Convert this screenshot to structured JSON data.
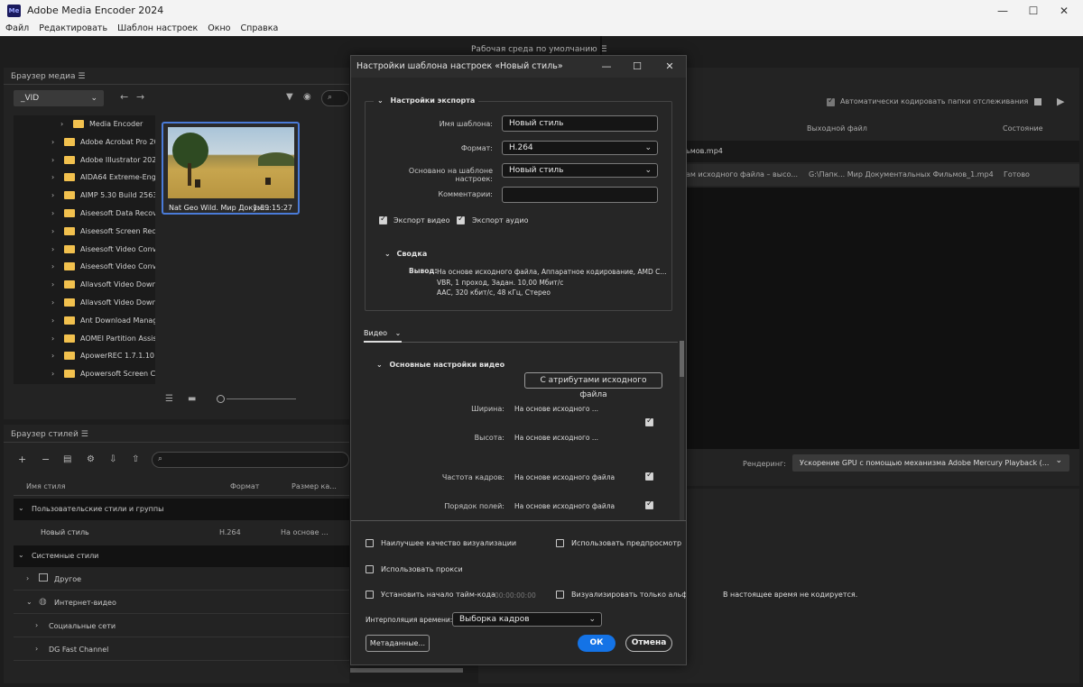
{
  "window": {
    "app_icon": "Me",
    "title": "Adobe Media Encoder 2024",
    "minimize": "—",
    "maximize": "☐",
    "close": "✕"
  },
  "menu": [
    "Файл",
    "Редактировать",
    "Шаблон настроек",
    "Окно",
    "Справка"
  ],
  "workspace": {
    "label": "Рабочая среда по умолчанию",
    "menu_icon": "☰"
  },
  "media_browser": {
    "title": "Браузер медиа",
    "menu_icon": "☰",
    "location": "_VID",
    "search_placeholder": "",
    "tree": [
      "Media Encoder",
      "Adobe Acrobat Pro 20",
      "Adobe Illustrator 2024",
      "AIDA64 Extreme-Engi",
      "AIMP 5.30 Build 2563",
      "Aiseesoft Data Recove",
      "Aiseesoft Screen Reco",
      "Aiseesoft Video Conv",
      "Aiseesoft Video Conv",
      "Allavsoft Video Down",
      "Allavsoft Video Down",
      "Ant Download Manag",
      "AOMEI Partition Assis",
      "ApowerREC 1.7.1.10 Re",
      "Apowersoft Screen Ca"
    ],
    "thumbnail": {
      "name": "Nat Geo Wild. Мир Докум...",
      "duration": "1:39:15:27"
    }
  },
  "style_browser": {
    "title": "Браузер стилей",
    "menu_icon": "☰",
    "columns": {
      "name": "Имя стиля",
      "format": "Формат",
      "size": "Размер ка..."
    },
    "groups": [
      {
        "label": "Пользовательские стили и группы"
      },
      {
        "label": "Новый стиль",
        "format": "H.264",
        "size": "На основе ..."
      },
      {
        "label": "Системные стили"
      },
      {
        "label": "Другое"
      },
      {
        "label": "Интернет-видео"
      },
      {
        "label": "Социальные сети"
      },
      {
        "label": "DG Fast Channel"
      }
    ]
  },
  "queue": {
    "auto_encode_label": "Автоматически кодировать папки отслеживания",
    "columns": {
      "output": "Выходной файл",
      "status": "Состояние"
    },
    "row1_name": "ьмов.mp4",
    "row2": {
      "preset": "ам исходного файла – высо...",
      "output": "G:\\Папк... Мир Документальных Фильмов_1.mp4",
      "status": "Готово"
    },
    "render_label": "Рендеринг:",
    "render_value": "Ускорение GPU с помощью механизма Adobe Mercury Playback (...",
    "encoding_status": "В настоящее время не кодируется."
  },
  "dialog": {
    "title": "Настройки шаблона настроек «Новый стиль»",
    "min": "—",
    "max": "☐",
    "close": "✕",
    "export_section": "Настройки экспорта",
    "name_label": "Имя шаблона:",
    "name_value": "Новый стиль",
    "format_label": "Формат:",
    "format_value": "H.264",
    "based_label": "Основано на шаблоне настроек:",
    "based_value": "Новый стиль",
    "comments_label": "Комментарии:",
    "comments_value": "",
    "export_video": "Экспорт видео",
    "export_audio": "Экспорт аудио",
    "summary_section": "Сводка",
    "output_label": "Вывод:",
    "output_lines": [
      "На основе исходного файла, Аппаратное кодирование, AMD C...",
      "VBR, 1 проход, Задан. 10,00 Мбит/с",
      "AAC, 320 кбит/с, 48 кГц, Стерео"
    ],
    "tab_video": "Видео",
    "basic_video_section": "Основные настройки видео",
    "match_source_btn": "С атрибутами исходного файла",
    "width_label": "Ширина:",
    "width_value": "На основе исходного ...",
    "height_label": "Высота:",
    "height_value": "На основе исходного ...",
    "fps_label": "Частота кадров:",
    "fps_value": "На основе исходного файла",
    "field_order_label": "Порядок полей:",
    "field_order_value": "На основе исходного файла",
    "max_quality": "Наилучшее качество визуализации",
    "use_preview": "Использовать предпросмотр",
    "use_proxy": "Использовать прокси",
    "set_timecode": "Установить начало тайм-кода",
    "timecode_value": "00:00:00:00",
    "render_alpha": "Визуализировать только альфа",
    "interp_label": "Интерполяция времени:",
    "interp_value": "Выборка кадров",
    "metadata_btn": "Метаданные...",
    "ok_btn": "ОК",
    "cancel_btn": "Отмена"
  },
  "colors": {
    "accent": "#1473e6",
    "selection": "#4a7bd8",
    "folder": "#f2c14e"
  }
}
